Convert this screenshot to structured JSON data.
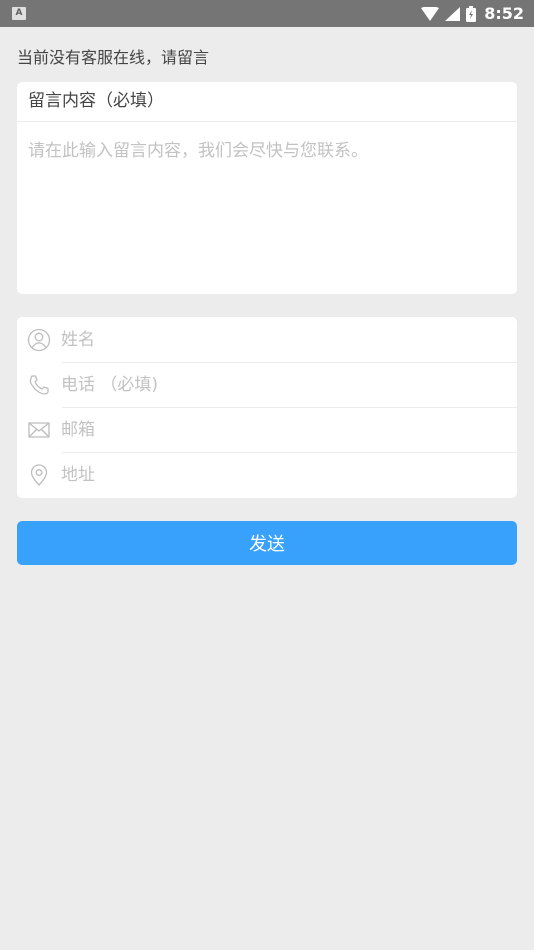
{
  "status_bar": {
    "left_badge": "A",
    "time": "8:52",
    "icons": [
      "wifi-icon",
      "signal-icon",
      "battery-icon"
    ]
  },
  "notice": "当前没有客服在线，请留言",
  "message": {
    "title": "留言内容（必填）",
    "placeholder": "请在此输入留言内容，我们会尽快与您联系。"
  },
  "fields": {
    "name": {
      "placeholder": "姓名",
      "icon": "person-icon"
    },
    "phone": {
      "placeholder": "电话 （必填)",
      "icon": "phone-icon"
    },
    "email": {
      "placeholder": "邮箱",
      "icon": "mail-icon"
    },
    "address": {
      "placeholder": "地址",
      "icon": "location-pin-icon"
    }
  },
  "send_label": "发送",
  "colors": {
    "background": "#ececec",
    "card": "#ffffff",
    "accent": "#38a1fb",
    "placeholder": "#c2c2c2",
    "status_bar": "#757575"
  }
}
